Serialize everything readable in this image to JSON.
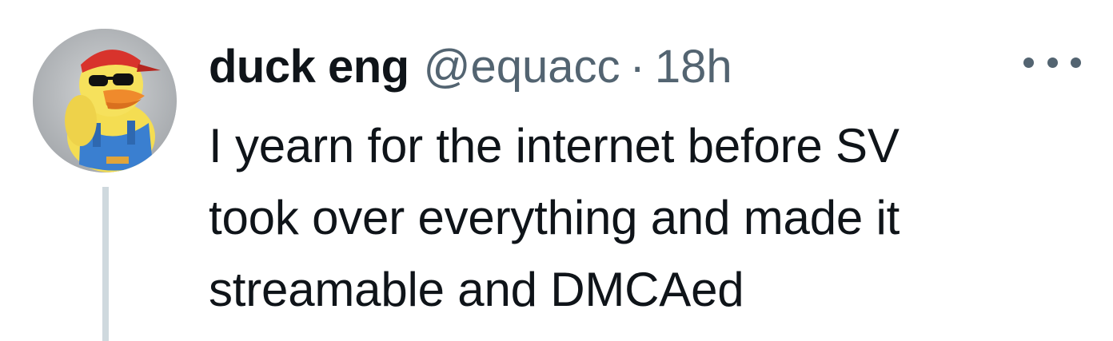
{
  "tweet": {
    "author": {
      "display_name": "duck eng",
      "handle": "@equacc",
      "avatar_icon": "rubber-duck-avatar"
    },
    "separator": "·",
    "timestamp": "18h",
    "more_icon": "more-horizontal-icon",
    "text": "I yearn for the internet before SV\ntook over everything and made it\nstreamable and DMCAed"
  },
  "colors": {
    "primary_text": "#0f1419",
    "secondary_text": "#536471",
    "thread_line": "#cfd9de",
    "background": "#ffffff"
  }
}
